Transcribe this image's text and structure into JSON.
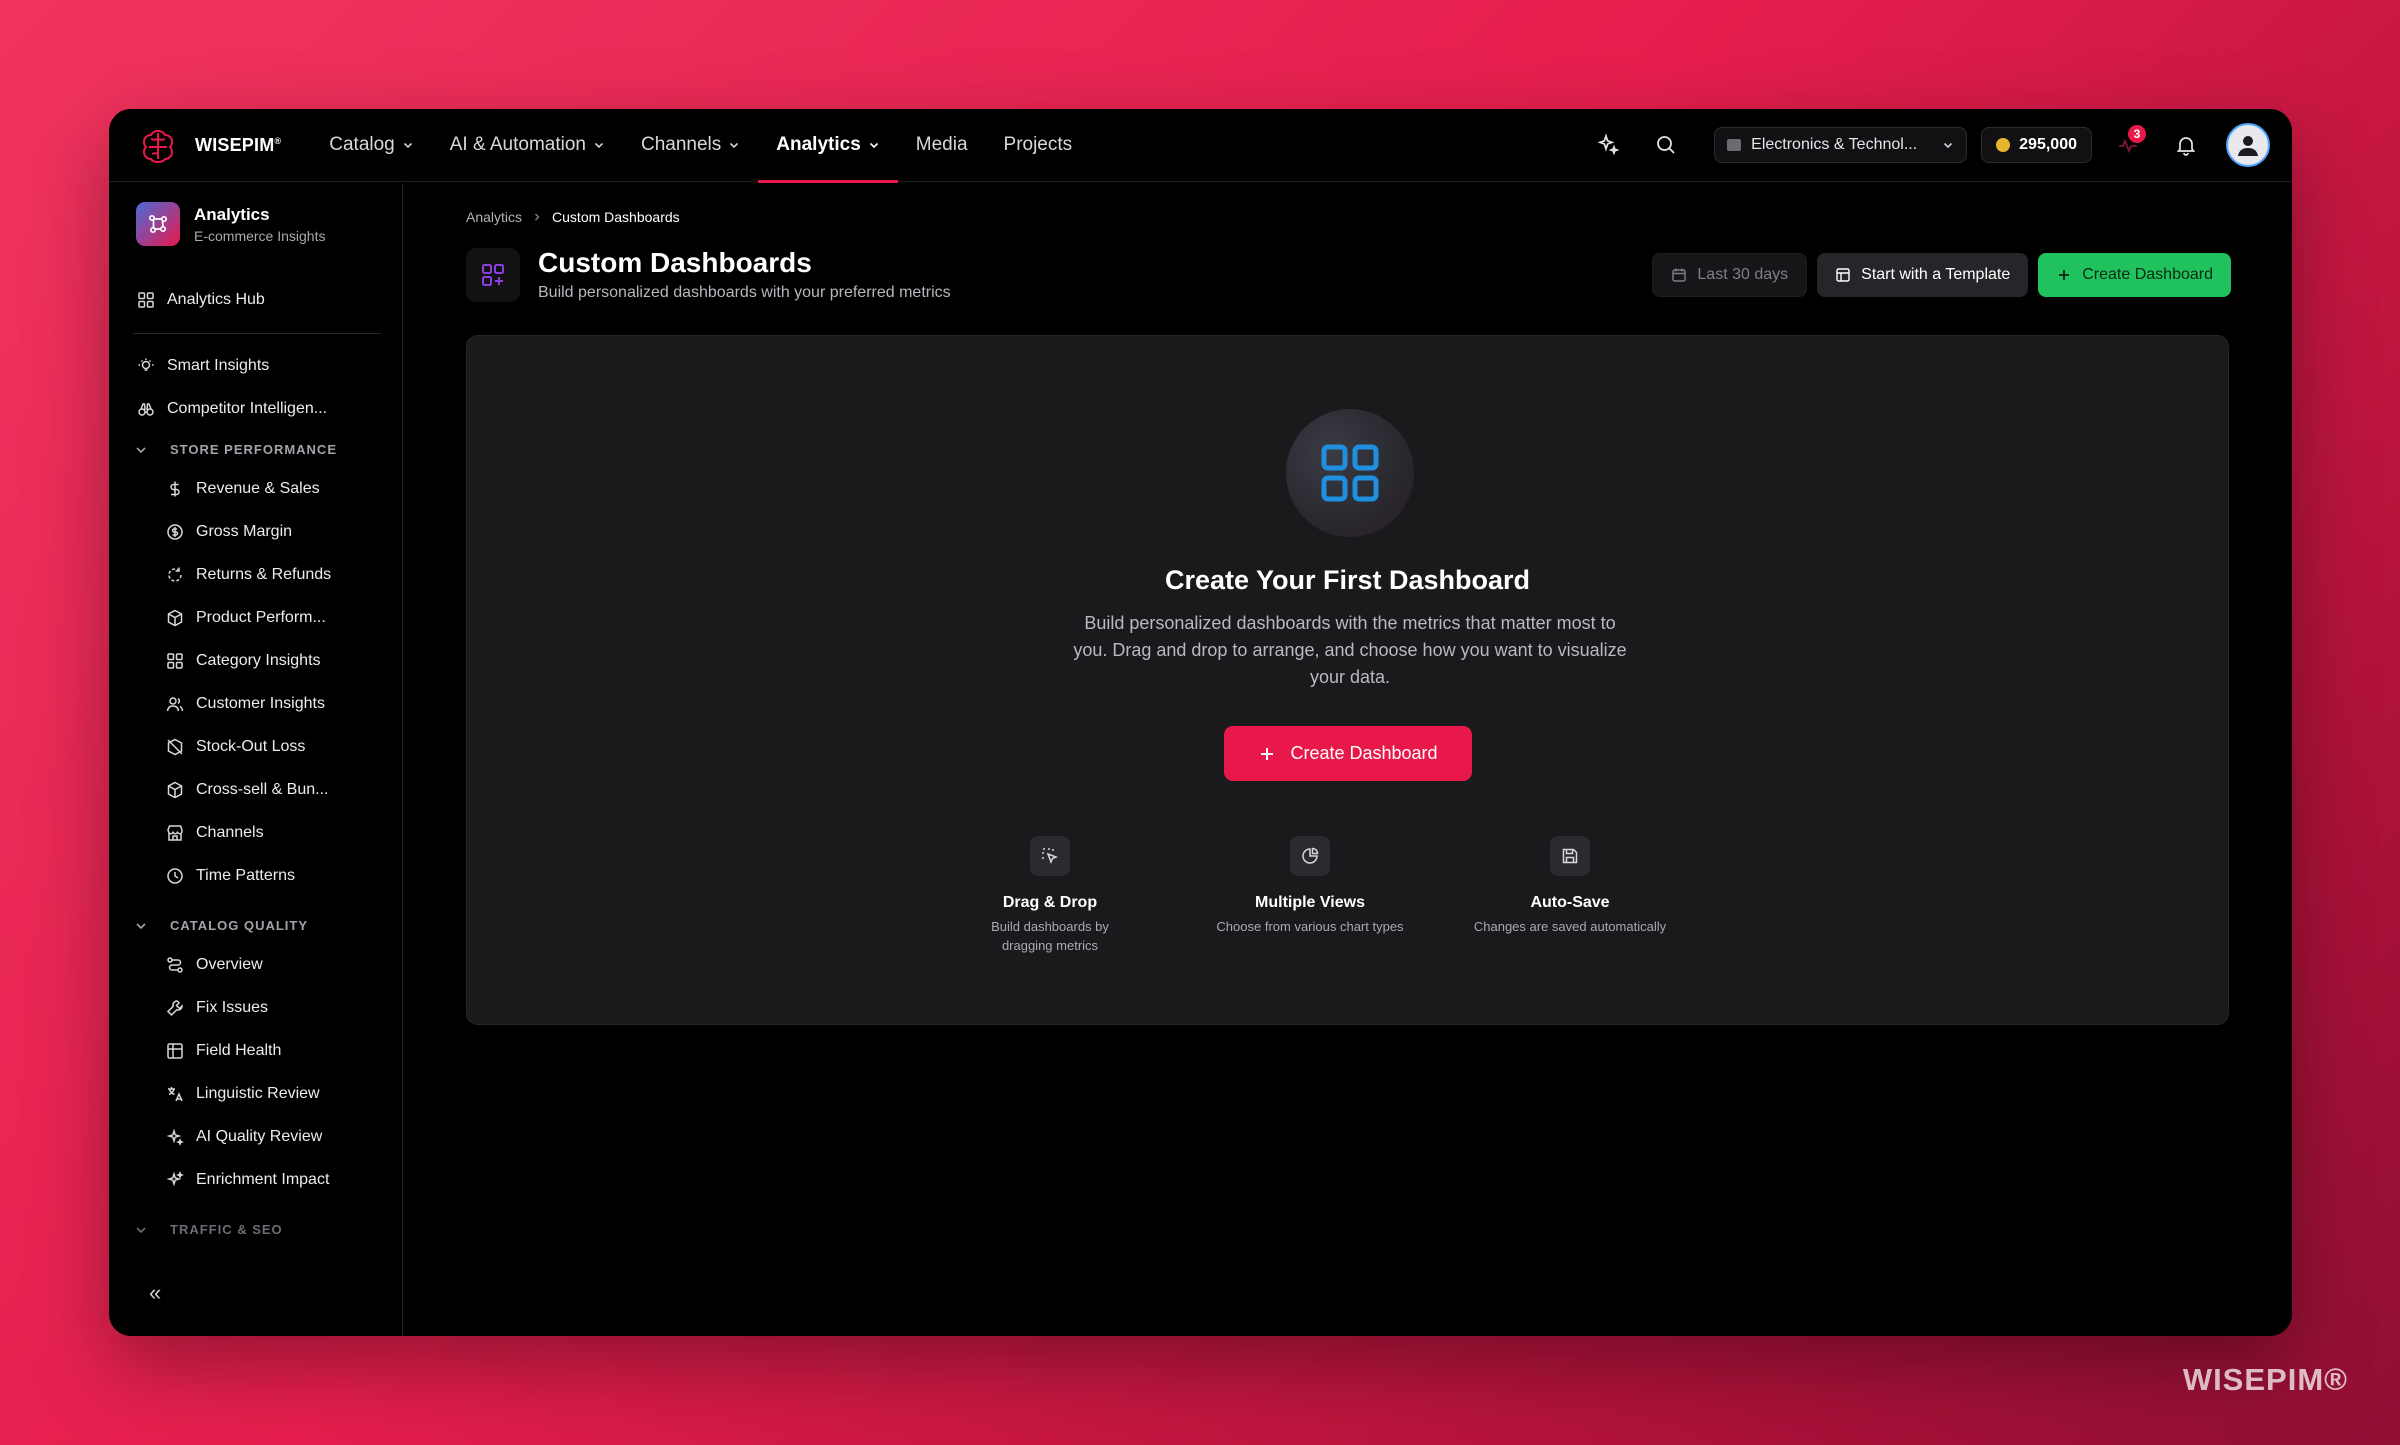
{
  "app": {
    "brand": "WISEPIM",
    "brand_mark": "®"
  },
  "nav": {
    "items": [
      {
        "label": "Catalog",
        "has_menu": true
      },
      {
        "label": "AI & Automation",
        "has_menu": true
      },
      {
        "label": "Channels",
        "has_menu": true
      },
      {
        "label": "Analytics",
        "has_menu": true,
        "active": true
      },
      {
        "label": "Media",
        "has_menu": false
      },
      {
        "label": "Projects",
        "has_menu": false
      }
    ],
    "store": "Electronics & Technol...",
    "credits": "295,000",
    "notifications_count": "3"
  },
  "sidebar": {
    "header": {
      "title": "Analytics",
      "subtitle": "E-commerce Insights"
    },
    "hub": "Analytics Hub",
    "top_items": [
      "Smart Insights",
      "Competitor Intelligen..."
    ],
    "sections": [
      {
        "title": "STORE PERFORMANCE",
        "items": [
          "Revenue & Sales",
          "Gross Margin",
          "Returns & Refunds",
          "Product Perform...",
          "Category Insights",
          "Customer Insights",
          "Stock-Out Loss",
          "Cross-sell & Bun...",
          "Channels",
          "Time Patterns"
        ]
      },
      {
        "title": "CATALOG QUALITY",
        "items": [
          "Overview",
          "Fix Issues",
          "Field Health",
          "Linguistic Review",
          "AI Quality Review",
          "Enrichment Impact"
        ]
      },
      {
        "title": "TRAFFIC & SEO",
        "items": []
      }
    ],
    "collapse_label": "«"
  },
  "main": {
    "breadcrumb": [
      "Analytics",
      "Custom Dashboards"
    ],
    "title": "Custom Dashboards",
    "subtitle": "Build personalized dashboards with your preferred metrics",
    "actions": {
      "date_range": "Last 30 days",
      "template": "Start with a Template",
      "create": "Create Dashboard"
    },
    "empty": {
      "title": "Create Your First Dashboard",
      "description": "Build personalized dashboards with the metrics that matter most to you. Drag and drop to arrange, and choose how you want to visualize your data.",
      "button": "Create Dashboard",
      "features": [
        {
          "title": "Drag & Drop",
          "description": "Build dashboards by dragging metrics",
          "icon": "drag-pointer-icon"
        },
        {
          "title": "Multiple Views",
          "description": "Choose from various chart types",
          "icon": "pie-chart-icon"
        },
        {
          "title": "Auto-Save",
          "description": "Changes are saved automatically",
          "icon": "save-icon"
        }
      ]
    }
  },
  "watermark": "WISEPIM®",
  "colors": {
    "accent": "#e8184a",
    "success": "#20c25d",
    "focus": "#4aa3ff"
  }
}
